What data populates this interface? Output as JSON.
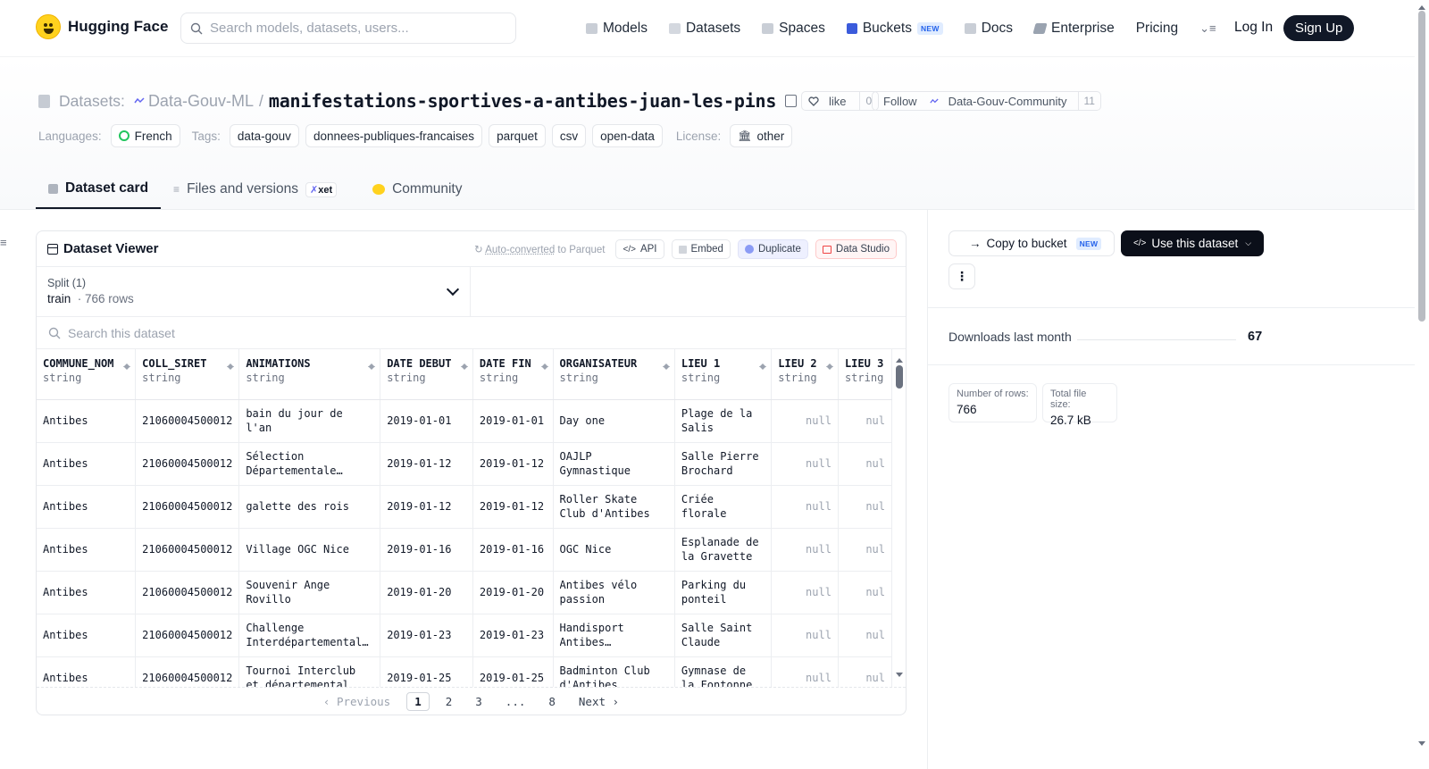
{
  "brand": {
    "name": "Hugging Face"
  },
  "search": {
    "placeholder": "Search models, datasets, users..."
  },
  "nav": {
    "items": [
      {
        "label": "Models",
        "icon": "cube-icon"
      },
      {
        "label": "Datasets",
        "icon": "database-icon"
      },
      {
        "label": "Spaces",
        "icon": "grid-icon"
      },
      {
        "label": "Buckets",
        "icon": "bucket-icon",
        "badge": "NEW"
      },
      {
        "label": "Docs",
        "icon": "book-icon"
      },
      {
        "label": "Enterprise",
        "icon": "enterprise-icon"
      },
      {
        "label": "Pricing"
      }
    ],
    "login": "Log In",
    "signup": "Sign Up"
  },
  "header": {
    "prefix": "Datasets:",
    "org": "Data-Gouv-ML",
    "separator": "/",
    "name": "manifestations-sportives-a-antibes-juan-les-pins",
    "like_label": "like",
    "like_count": "0",
    "follow_label": "Follow",
    "follow_org": "Data-Gouv-Community",
    "follow_count": "11",
    "languages_label": "Languages:",
    "language": "French",
    "tags_label": "Tags:",
    "tags": [
      "data-gouv",
      "donnees-publiques-francaises",
      "parquet",
      "csv",
      "open-data"
    ],
    "license_label": "License:",
    "license": "other"
  },
  "tabs": [
    {
      "label": "Dataset card"
    },
    {
      "label": "Files and versions",
      "badge": "xet"
    },
    {
      "label": "Community"
    }
  ],
  "viewer": {
    "title": "Dataset Viewer",
    "auto_link": "Auto-converted",
    "auto_rest": " to Parquet",
    "buttons": {
      "api": "API",
      "embed": "Embed",
      "duplicate": "Duplicate",
      "studio": "Data Studio"
    },
    "split_label": "Split (1)",
    "split_value": "train",
    "split_rows": "766 rows",
    "search_placeholder": "Search this dataset",
    "columns": [
      {
        "name": "COMMUNE_NOM",
        "type": "string"
      },
      {
        "name": "COLL_SIRET",
        "type": "string"
      },
      {
        "name": "ANIMATIONS",
        "type": "string"
      },
      {
        "name": "DATE DEBUT",
        "type": "string"
      },
      {
        "name": "DATE FIN",
        "type": "string"
      },
      {
        "name": "ORGANISATEUR",
        "type": "string"
      },
      {
        "name": "LIEU 1",
        "type": "string"
      },
      {
        "name": "LIEU 2",
        "type": "string"
      },
      {
        "name": "LIEU 3",
        "type": "string"
      }
    ],
    "rows": [
      [
        "Antibes",
        "21060004500012",
        "bain du jour de l'an",
        "2019-01-01",
        "2019-01-01",
        "Day one",
        "Plage de la Salis",
        "null",
        "nul"
      ],
      [
        "Antibes",
        "21060004500012",
        "Sélection Départementale…",
        "2019-01-12",
        "2019-01-12",
        "OAJLP Gymnastique",
        "Salle Pierre Brochard",
        "null",
        "nul"
      ],
      [
        "Antibes",
        "21060004500012",
        "galette des rois",
        "2019-01-12",
        "2019-01-12",
        "Roller Skate Club d'Antibes",
        "Criée florale",
        "null",
        "nul"
      ],
      [
        "Antibes",
        "21060004500012",
        "Village OGC Nice",
        "2019-01-16",
        "2019-01-16",
        "OGC Nice",
        "Esplanade de la Gravette",
        "null",
        "nul"
      ],
      [
        "Antibes",
        "21060004500012",
        "Souvenir Ange Rovillo",
        "2019-01-20",
        "2019-01-20",
        "Antibes vélo passion",
        "Parking du ponteil",
        "null",
        "nul"
      ],
      [
        "Antibes",
        "21060004500012",
        "Challenge Interdépartemental…",
        "2019-01-23",
        "2019-01-23",
        "Handisport Antibes…",
        "Salle Saint Claude",
        "null",
        "nul"
      ],
      [
        "Antibes",
        "21060004500012",
        "Tournoi Interclub et départemental jeunes",
        "2019-01-25",
        "2019-01-25",
        "Badminton Club d'Antibes",
        "Gymnase de la Fontonne",
        "null",
        "nul"
      ]
    ],
    "pagination": {
      "previous": "Previous",
      "pages": [
        "1",
        "2",
        "3",
        "...",
        "8"
      ],
      "next": "Next",
      "current": "1"
    }
  },
  "sidebar": {
    "copy_bucket": "Copy to bucket",
    "copy_badge": "NEW",
    "use_dataset": "Use this dataset",
    "more": "⋮",
    "downloads_label": "Downloads last month",
    "downloads_value": "67",
    "rows_label": "Number of rows:",
    "rows_value": "766",
    "size_label": "Total file size:",
    "size_value": "26.7 kB"
  }
}
